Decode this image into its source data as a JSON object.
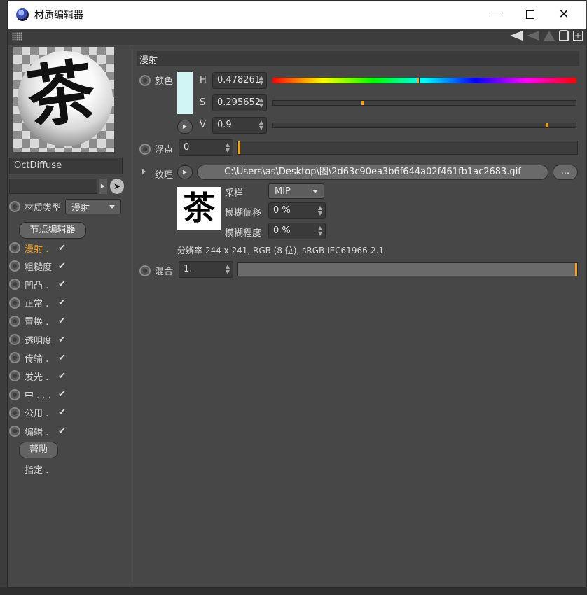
{
  "window": {
    "title": "材质编辑器"
  },
  "material": {
    "name": "OctDiffuse",
    "type_label": "材质类型",
    "type_value": "漫射",
    "node_editor_label": "节点编辑器",
    "help_label": "帮助",
    "assign_label": "指定 ."
  },
  "channels": [
    {
      "label": "漫射 .",
      "checked": true,
      "active": true
    },
    {
      "label": "粗糙度",
      "checked": true,
      "active": false
    },
    {
      "label": "凹凸 .",
      "checked": true,
      "active": false
    },
    {
      "label": "正常 .",
      "checked": true,
      "active": false
    },
    {
      "label": "置换 .",
      "checked": true,
      "active": false
    },
    {
      "label": "透明度",
      "checked": true,
      "active": false
    },
    {
      "label": "传输 .",
      "checked": true,
      "active": false
    },
    {
      "label": "发光 .",
      "checked": true,
      "active": false
    },
    {
      "label": "中 . . .",
      "checked": true,
      "active": false
    },
    {
      "label": "公用 .",
      "checked": true,
      "active": false
    },
    {
      "label": "编辑 .",
      "checked": true,
      "active": false
    }
  ],
  "checkmark": "✔",
  "diffuse": {
    "section_title": "漫射",
    "color_label": "颜色",
    "swatch_color": "#d1f5f4",
    "h_label": "H",
    "h_value": "0.478261",
    "s_label": "S",
    "s_value": "0.295652",
    "v_label": "V",
    "v_value": "0.9",
    "h_fraction": 0.478261,
    "s_fraction": 0.295652,
    "v_fraction": 0.9,
    "float_label": "浮点",
    "float_value": "0",
    "texture_label": "纹理",
    "texture_path": "C:\\Users\\as\\Desktop\\图\\2d63c90ea3b6f644a02f461fb1ac2683.gif",
    "browse_label": "...",
    "thumb_glyph": "茶",
    "sampling_label": "采样",
    "sampling_value": "MIP",
    "blur_offset_label": "模糊偏移",
    "blur_offset_value": "0 %",
    "blur_amount_label": "模糊程度",
    "blur_amount_value": "0 %",
    "resolution": "分辨率 244 x 241, RGB (8 位), sRGB IEC61966-2.1",
    "mix_label": "混合",
    "mix_value": "1.",
    "mix_fraction": 1.0
  },
  "preview": {
    "glyph": "茶"
  },
  "accent_color": "#f0a020"
}
